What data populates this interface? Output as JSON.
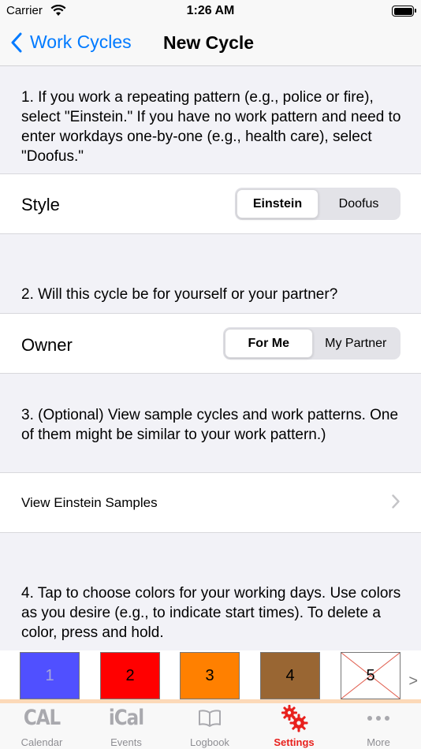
{
  "status": {
    "carrier": "Carrier",
    "time": "1:26 AM"
  },
  "nav": {
    "back_label": "Work Cycles",
    "title": "New Cycle"
  },
  "sections": {
    "style_header": "1.  If you work a repeating pattern (e.g., police or fire), select \"Einstein.\"  If you have no work pattern and need to enter workdays one-by-one (e.g., health care), select \"Doofus.\"",
    "style_label": "Style",
    "style_options": [
      "Einstein",
      "Doofus"
    ],
    "style_selected": "Einstein",
    "owner_header": "2.  Will this cycle be for yourself or your partner?",
    "owner_label": "Owner",
    "owner_options": [
      "For Me",
      "My Partner"
    ],
    "owner_selected": "For Me",
    "samples_header": "3.  (Optional) View sample cycles and work patterns.  One of them might be similar to your work pattern.)",
    "samples_link": "View Einstein Samples",
    "colors_header": "4.  Tap to choose colors for your working days.  Use colors as you desire (e.g., to indicate start times).  To delete a color, press and hold."
  },
  "colors": {
    "swatches": [
      {
        "label": "1",
        "color": "#5050ff",
        "text_color": "#a7a7d8"
      },
      {
        "label": "2",
        "color": "#ff0000",
        "text_color": "#000000"
      },
      {
        "label": "3",
        "color": "#ff8000",
        "text_color": "#000000"
      },
      {
        "label": "4",
        "color": "#996633",
        "text_color": "#000000"
      },
      {
        "label": "5",
        "color": "",
        "text_color": "#000000"
      }
    ],
    "more_label": ">"
  },
  "tabs": [
    {
      "label": "Calendar",
      "icon": "cal-logo-icon",
      "icon_text": "CAL"
    },
    {
      "label": "Events",
      "icon": "ical-logo-icon",
      "icon_text": "iCal"
    },
    {
      "label": "Logbook",
      "icon": "book-icon"
    },
    {
      "label": "Settings",
      "icon": "gears-icon",
      "active": true
    },
    {
      "label": "More",
      "icon": "more-dots-icon"
    }
  ],
  "accent": "#007aff",
  "active_tab_color": "#e8211d"
}
